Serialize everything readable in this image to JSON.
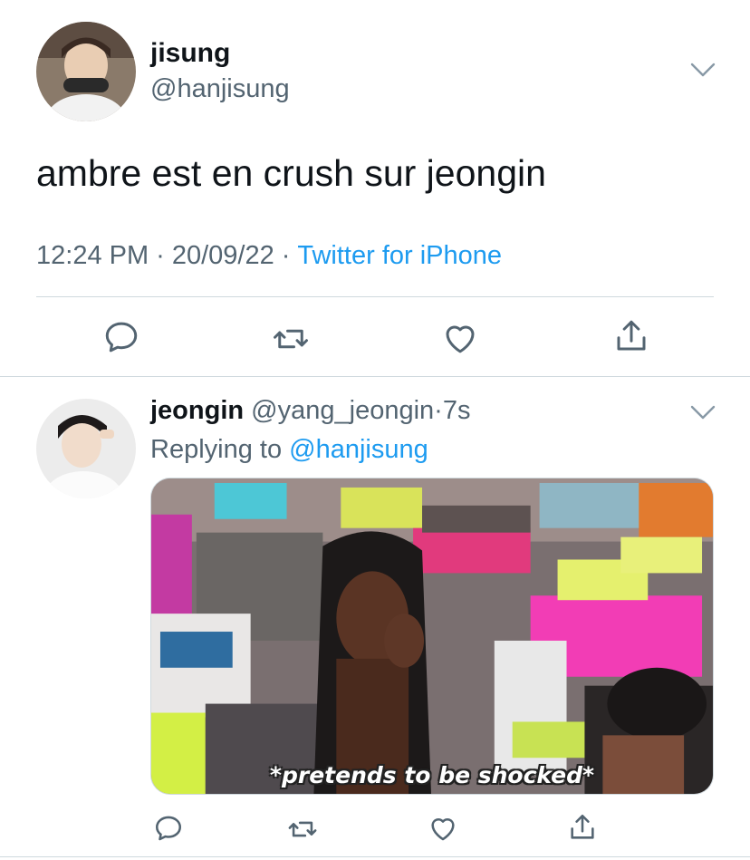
{
  "tweet": {
    "author_name": "jisung",
    "author_handle": "@hanjisung",
    "text": "ambre est en crush sur jeongin",
    "time": "12:24 PM",
    "date": "20/09/22",
    "source": "Twitter for iPhone",
    "separator": "·"
  },
  "reply": {
    "author_name": "jeongin",
    "author_handle": "@yang_jeongin",
    "age": "7s",
    "separator": "·",
    "replying_prefix": "Replying to",
    "replying_to": "@hanjisung",
    "media_caption": "*pretends to be shocked*"
  },
  "colors": {
    "text": "#0f1419",
    "secondary": "#536471",
    "accent": "#1d9bf0",
    "divider": "#cfd9de"
  },
  "icons": {
    "menu": "chevron-down-icon",
    "reply": "reply-icon",
    "retweet": "retweet-icon",
    "like": "heart-icon",
    "share": "share-icon"
  }
}
